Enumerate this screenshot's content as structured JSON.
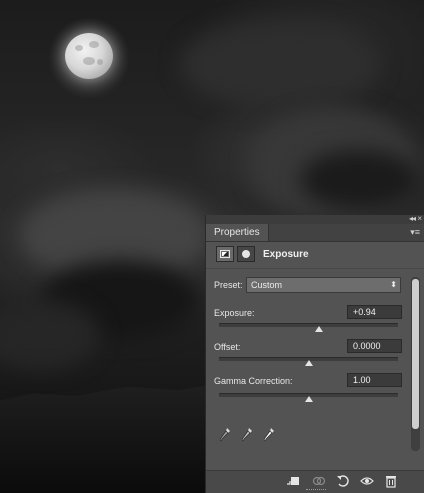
{
  "panel": {
    "tab_label": "Properties",
    "collapse_icon": "double-chevron-left-icon",
    "close_icon": "close-icon",
    "menu_icon": "panel-menu-icon",
    "adjustment_title": "Exposure",
    "preset_label": "Preset:",
    "preset_value": "Custom",
    "exposure_label": "Exposure:",
    "exposure_value": "+0.94",
    "exposure_slider_position": 0.56,
    "offset_label": "Offset:",
    "offset_value": "0.0000",
    "offset_slider_position": 0.5,
    "gamma_label": "Gamma Correction:",
    "gamma_value": "1.00",
    "gamma_slider_position": 0.5,
    "eyedroppers": [
      "sample-black-eyedropper-icon",
      "sample-gray-eyedropper-icon",
      "sample-white-eyedropper-icon"
    ],
    "bottom_icons": [
      "clip-to-layer-icon",
      "view-previous-state-icon",
      "reset-icon",
      "visibility-eye-icon",
      "trash-icon"
    ]
  },
  "colors": {
    "panel_bg": "#535353",
    "field_bg": "#3b3b3b",
    "text": "#e8e8e8"
  }
}
